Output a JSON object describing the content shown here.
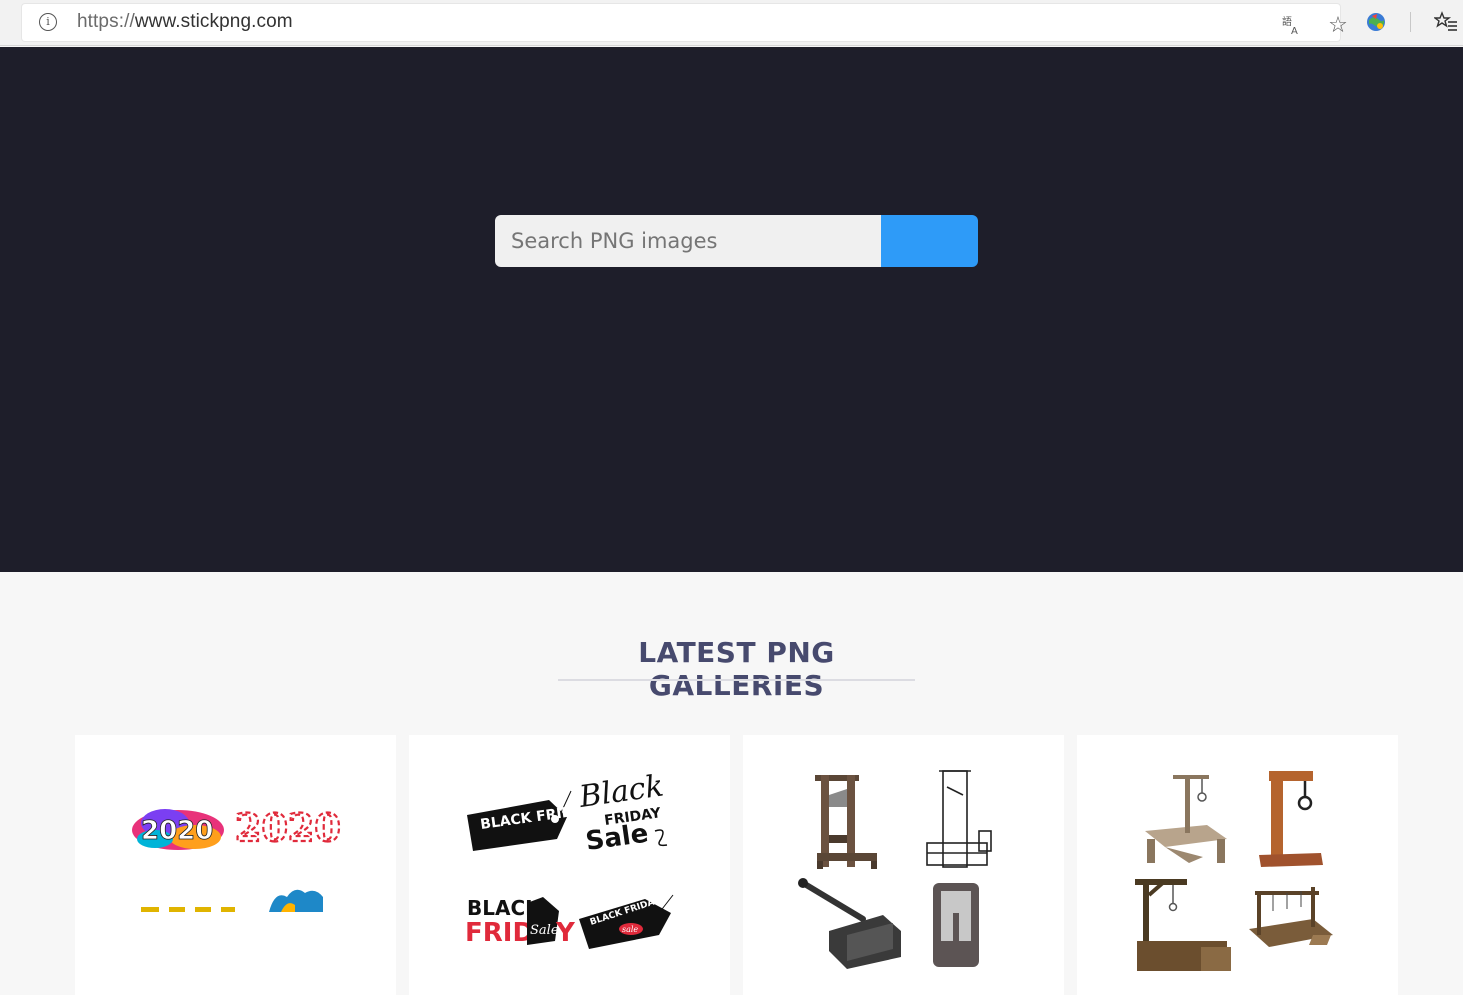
{
  "browser": {
    "url_scheme": "https://",
    "url_host": "www.stickpng.com",
    "icons": [
      "info-icon",
      "translate-icon",
      "star-icon",
      "extension-icon",
      "favorites-icon"
    ]
  },
  "hero": {
    "search_placeholder": "Search PNG images",
    "search_button_color": "#2e9bf8",
    "background": "#1e1e2a"
  },
  "section": {
    "title": "LATEST PNG GALLERIES"
  },
  "galleries": [
    {
      "name": "2020",
      "thumbs": [
        "2020",
        "2020"
      ]
    },
    {
      "name": "Black Friday",
      "thumbs": [
        "BLACK FRIDAY",
        "Black",
        "FRIDAY",
        "Sale",
        "BLACK",
        "FRID",
        "Sale",
        "Y",
        "BLACK FRIDAY",
        "sale"
      ]
    },
    {
      "name": "Guillotine"
    },
    {
      "name": "Gallows"
    }
  ]
}
